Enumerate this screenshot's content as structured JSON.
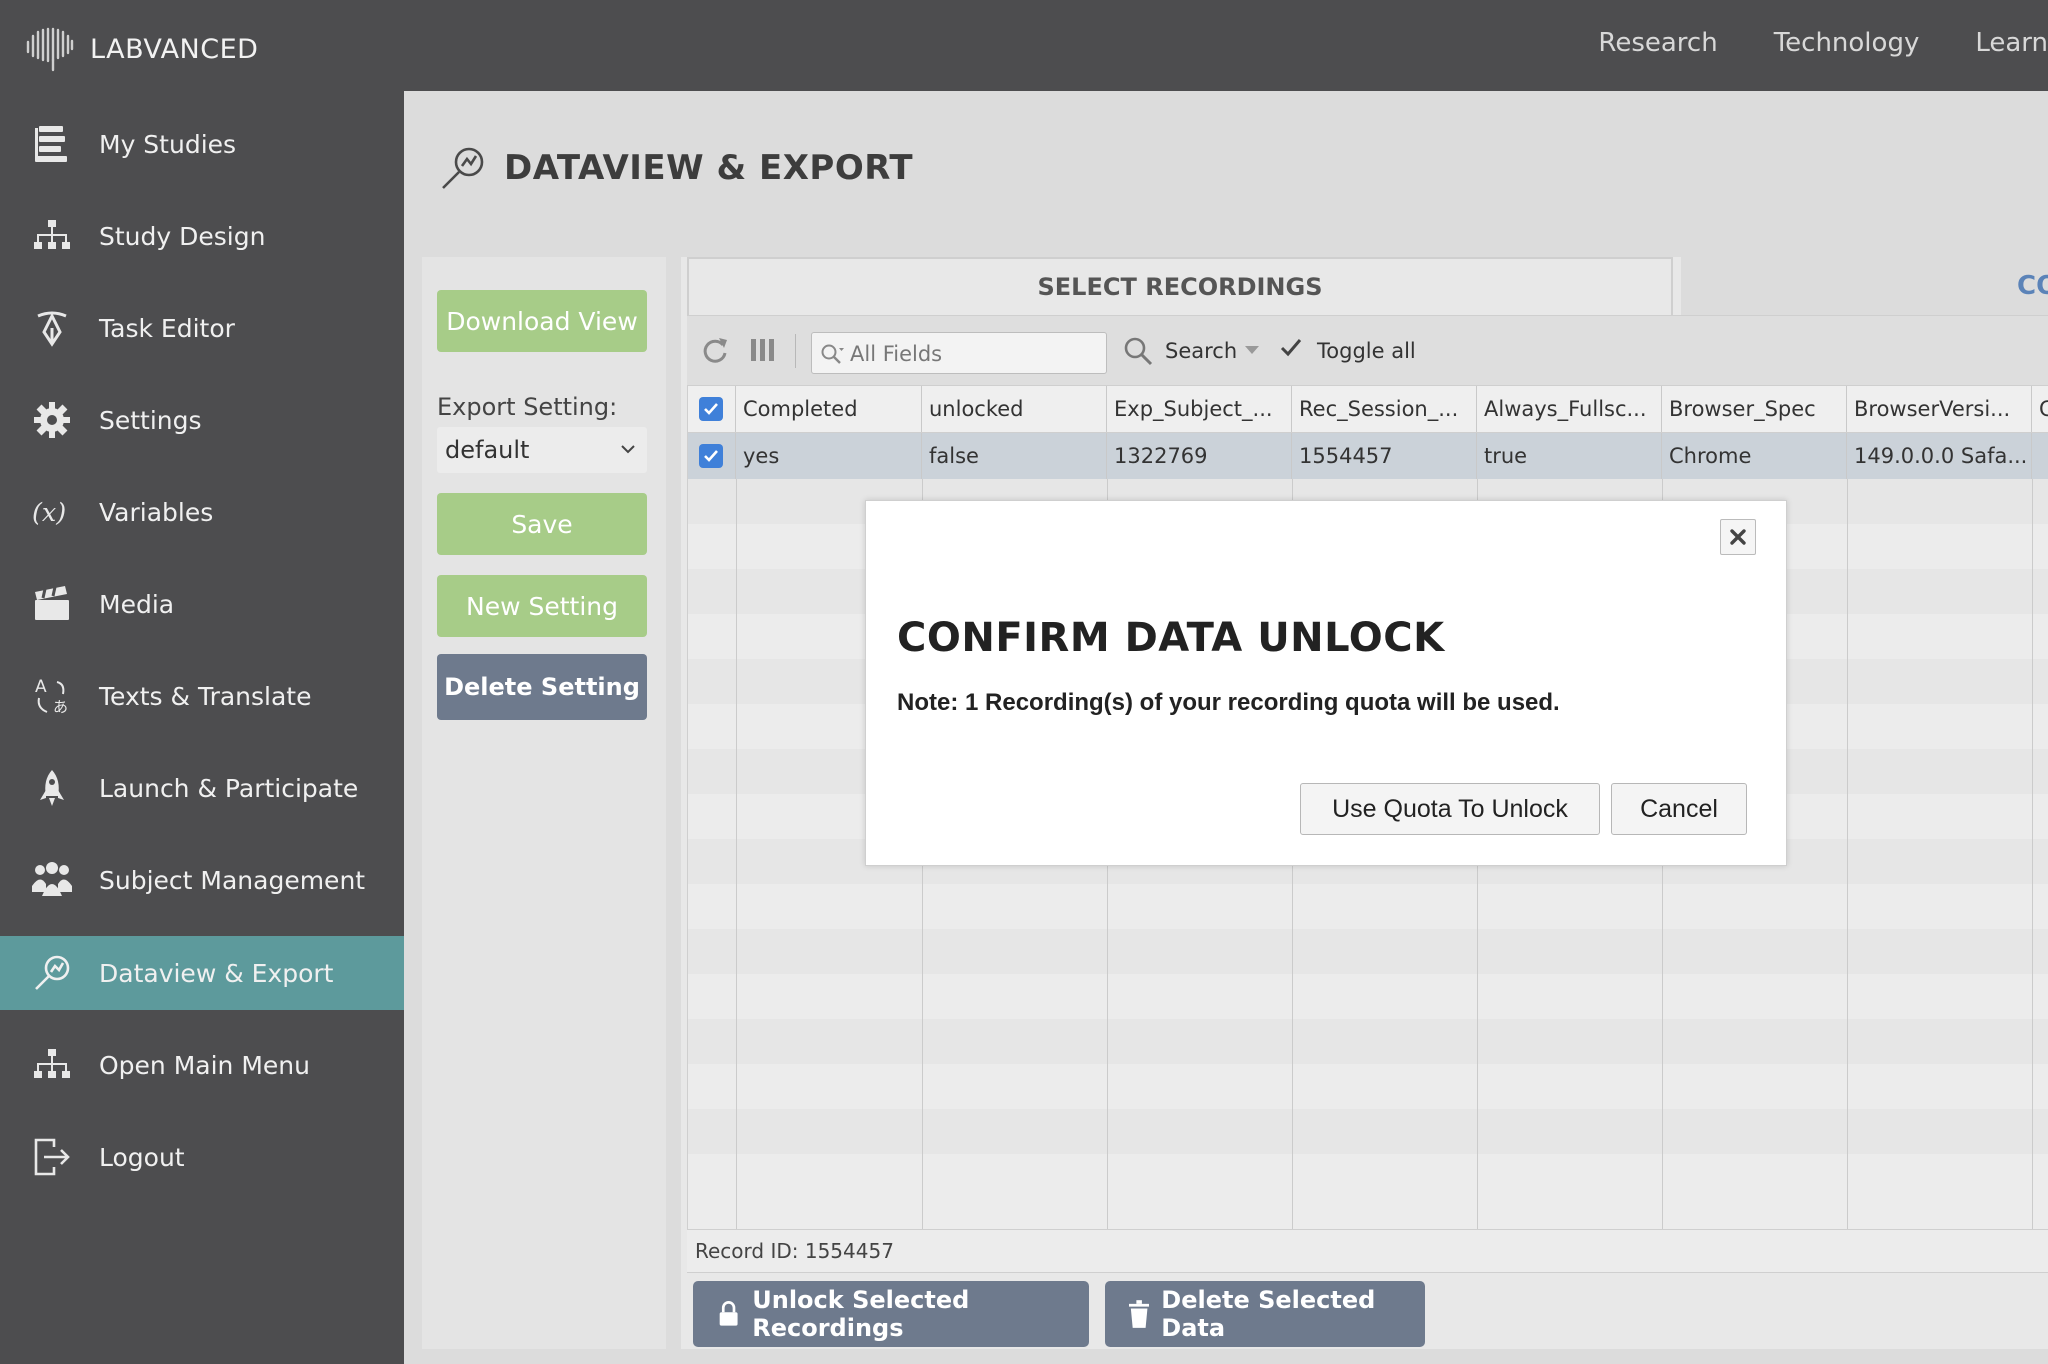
{
  "app": {
    "brand": "LABVANCED"
  },
  "topnav": {
    "items": [
      "Research",
      "Technology",
      "Learn"
    ]
  },
  "sidebar": {
    "items": [
      {
        "label": "My Studies",
        "icon": "studies-icon"
      },
      {
        "label": "Study Design",
        "icon": "hierarchy-icon"
      },
      {
        "label": "Task Editor",
        "icon": "pen-icon"
      },
      {
        "label": "Settings",
        "icon": "gear-icon"
      },
      {
        "label": "Variables",
        "icon": "variable-icon"
      },
      {
        "label": "Media",
        "icon": "clapperboard-icon"
      },
      {
        "label": "Texts & Translate",
        "icon": "translate-icon"
      },
      {
        "label": "Launch & Participate",
        "icon": "rocket-icon"
      },
      {
        "label": "Subject Management",
        "icon": "people-icon"
      },
      {
        "label": "Dataview & Export",
        "icon": "magnifier-chart-icon",
        "active": true
      },
      {
        "label": "Open Main Menu",
        "icon": "hierarchy-icon"
      },
      {
        "label": "Logout",
        "icon": "logout-icon"
      }
    ],
    "active_color": "#5d9a9c"
  },
  "page": {
    "title": "DATAVIEW & EXPORT"
  },
  "left_panel": {
    "download_view": "Download View",
    "export_setting_label": "Export Setting:",
    "export_setting_value": "default",
    "save": "Save",
    "new_setting": "New Setting",
    "delete_setting": "Delete Setting"
  },
  "tabs": {
    "active": "SELECT RECORDINGS",
    "other": "CO"
  },
  "toolbar": {
    "search_placeholder": "All Fields",
    "search_label": "Search",
    "toggle_all": "Toggle all"
  },
  "table": {
    "columns": [
      "Completed",
      "unlocked",
      "Exp_Subject_...",
      "Rec_Session_...",
      "Always_Fullsc...",
      "Browser_Spec",
      "BrowserVersi...",
      "C"
    ],
    "rows": [
      [
        "yes",
        "false",
        "1322769",
        "1554457",
        "true",
        "Chrome",
        "149.0.0.0 Safa...",
        ""
      ]
    ]
  },
  "status": {
    "record_id": "Record ID: 1554457"
  },
  "actions": {
    "unlock": "Unlock Selected Recordings",
    "delete": "Delete Selected Data"
  },
  "modal": {
    "title": "CONFIRM DATA UNLOCK",
    "note": "Note: 1 Recording(s) of your recording quota will be used.",
    "confirm": "Use Quota To Unlock",
    "cancel": "Cancel"
  }
}
